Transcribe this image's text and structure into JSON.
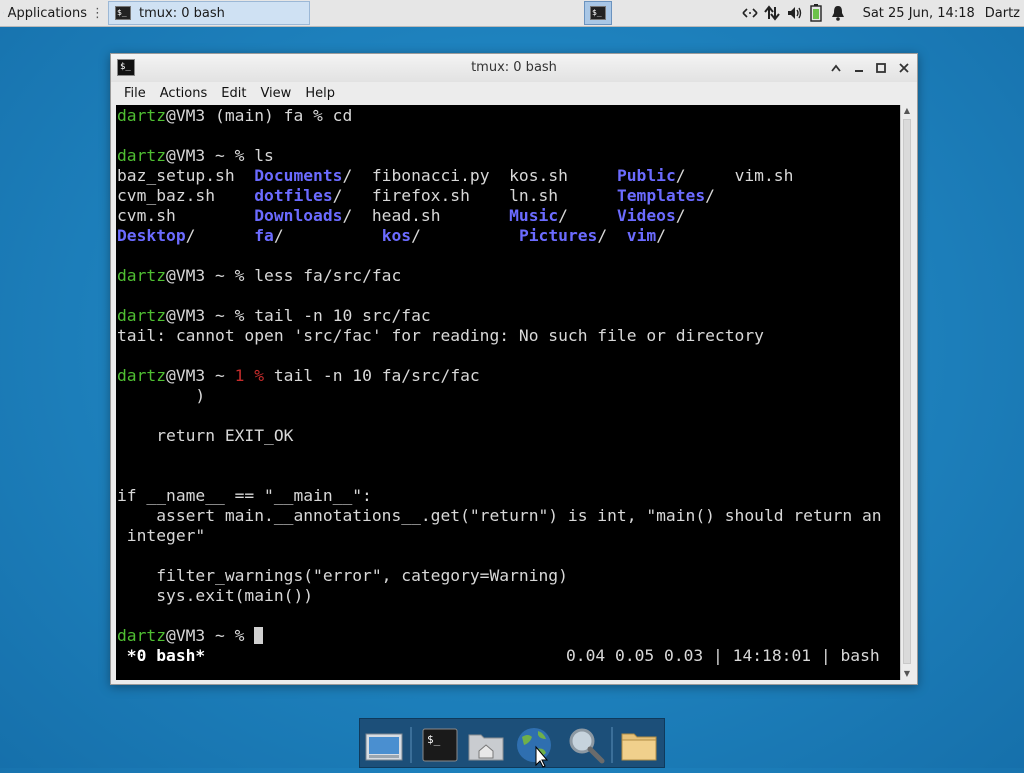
{
  "top_panel": {
    "applications_label": "Applications",
    "task_label": "tmux: 0 bash",
    "clock": "Sat 25 Jun, 14:18",
    "user": "Dartz",
    "tray_icons": [
      "network-arrows-icon",
      "transfer-icon",
      "volume-icon",
      "battery-icon",
      "bell-icon"
    ]
  },
  "window": {
    "title": "tmux: 0 bash",
    "menu": [
      "File",
      "Actions",
      "Edit",
      "View",
      "Help"
    ]
  },
  "terminal": {
    "prompt_user": "dartz",
    "prompt_host": "@VM3",
    "lines": {
      "l1_rest": " (main) fa % cd",
      "l3_rest": " ~ % ls",
      "ls_r1_a": "baz_setup.sh  ",
      "ls_r1_b": "Documents",
      "ls_r1_c": "/  fibonacci.py  kos.sh     ",
      "ls_r1_d": "Public",
      "ls_r1_e": "/     vim.sh",
      "ls_r2_a": "cvm_baz.sh    ",
      "ls_r2_b": "dotfiles",
      "ls_r2_c": "/   firefox.sh    ln.sh      ",
      "ls_r2_d": "Templates",
      "ls_r2_e": "/",
      "ls_r3_a": "cvm.sh        ",
      "ls_r3_b": "Downloads",
      "ls_r3_c": "/  head.sh       ",
      "ls_r3_d": "Music",
      "ls_r3_e": "/     ",
      "ls_r3_f": "Videos",
      "ls_r3_g": "/",
      "ls_r4_a": "Desktop",
      "ls_r4_b": "/      ",
      "ls_r4_c": "fa",
      "ls_r4_d": "/          ",
      "ls_r4_e": "kos",
      "ls_r4_f": "/          ",
      "ls_r4_g": "Pictures",
      "ls_r4_h": "/  ",
      "ls_r4_i": "vim",
      "ls_r4_j": "/",
      "less_rest": " ~ % less fa/src/fac",
      "tail1_rest": " ~ % tail -n 10 src/fac",
      "tail_err": "tail: cannot open 'src/fac' for reading: No such file or directory",
      "tail2_mid": " ~ ",
      "tail2_status": "1 %",
      "tail2_rest": " tail -n 10 fa/src/fac",
      "code1": "        )",
      "code2": "    return EXIT_OK",
      "code3": "if __name__ == \"__main__\":",
      "code4": "    assert main.__annotations__.get(\"return\") is int, \"main() should return an",
      "code5": " integer\"",
      "code6": "    filter_warnings(\"error\", category=Warning)",
      "code7": "    sys.exit(main())",
      "final_rest": " ~ % "
    },
    "status_left": " *0 bash*",
    "status_right": "0.04 0.05 0.03 | 14:18:01 | bash"
  },
  "dock": {
    "items": [
      "desktop-icon",
      "terminal-icon",
      "home-folder-icon",
      "web-browser-icon",
      "search-icon",
      "folder-icon"
    ]
  }
}
